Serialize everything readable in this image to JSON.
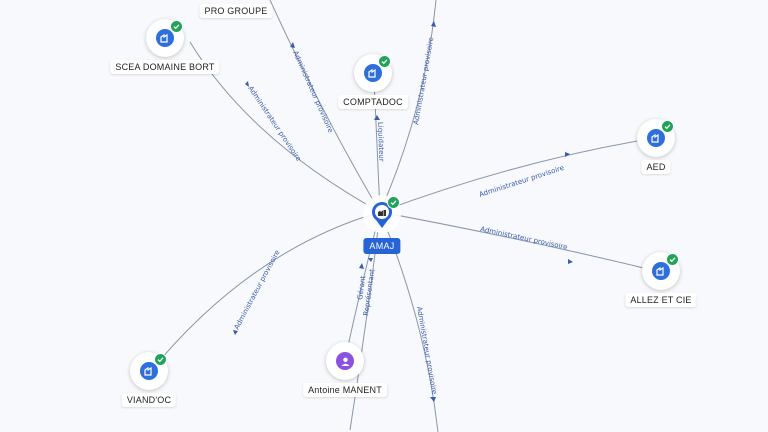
{
  "center": {
    "name": "AMAJ"
  },
  "nodes": {
    "scea": "SCEA DOMAINE BORT",
    "comptadoc": "COMPTADOC",
    "aed": "AED",
    "allez": "ALLEZ ET CIE",
    "viand": "VIAND'OC",
    "antoine": "Antoine MANENT",
    "top_cut": "PRO GROUPE"
  },
  "edge_labels": {
    "admin": "Administrateur provisoire",
    "liquidateur": "Liquidateur",
    "gerant": "Gérant",
    "representant": "Représentant"
  },
  "colors": {
    "company": "#2f6fdb",
    "person": "#8b52e0",
    "verified": "#22a35a",
    "center_label": "#2563d6"
  }
}
